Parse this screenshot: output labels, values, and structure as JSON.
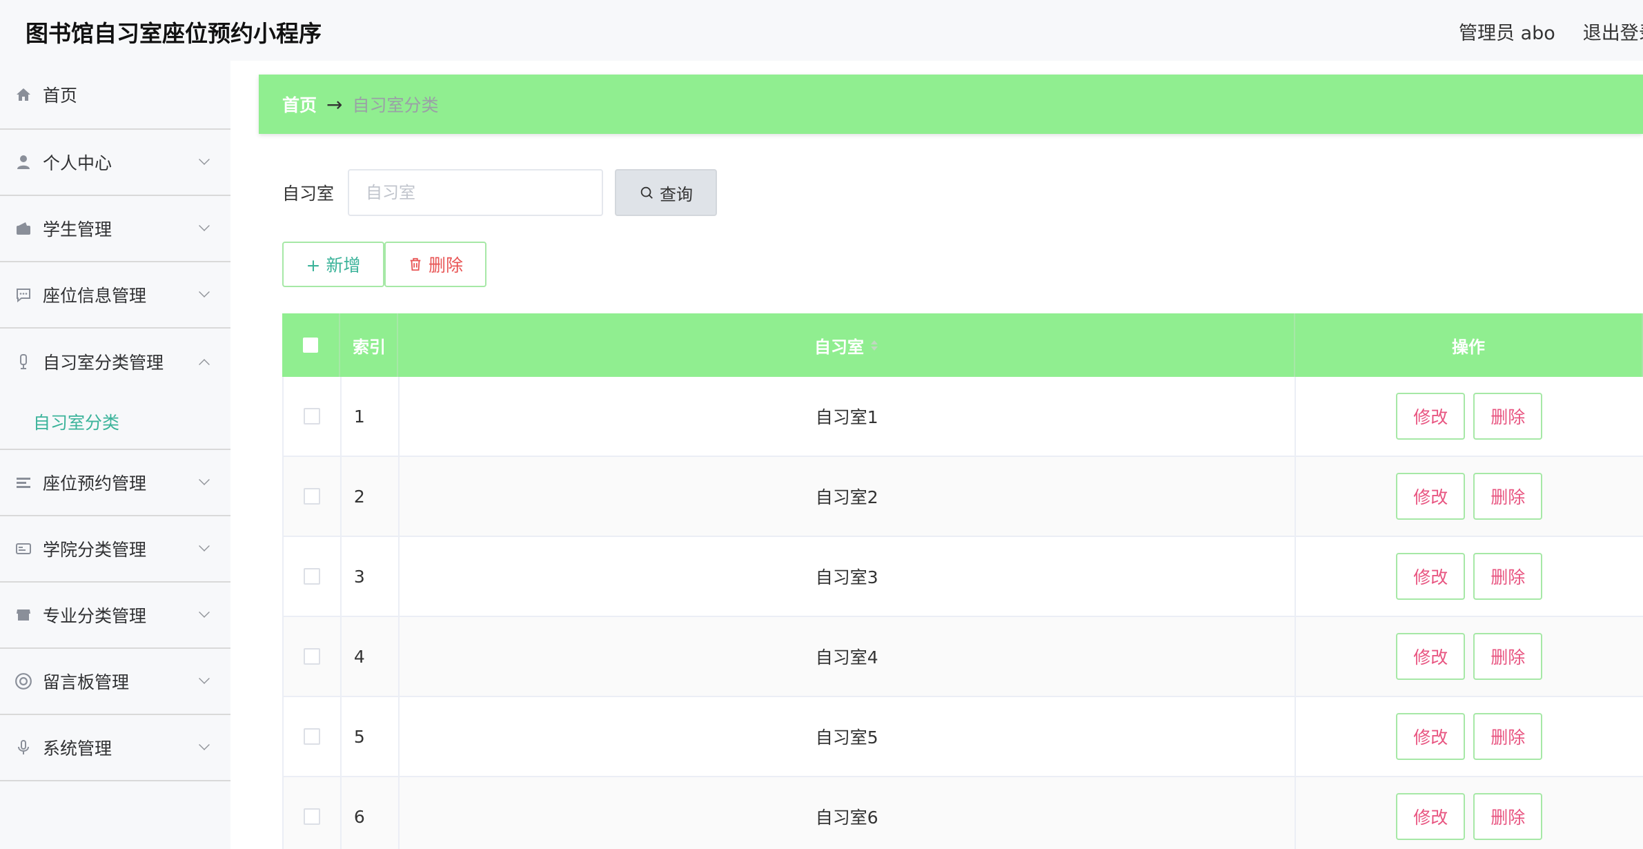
{
  "header": {
    "title": "图书馆自习室座位预约小程序",
    "admin": "管理员 abo",
    "logout": "退出登录"
  },
  "sidebar": {
    "items": [
      {
        "label": "首页",
        "icon": "home-icon"
      },
      {
        "label": "个人中心",
        "icon": "user-icon"
      },
      {
        "label": "学生管理",
        "icon": "wallet-icon"
      },
      {
        "label": "座位信息管理",
        "icon": "chat-icon"
      },
      {
        "label": "自习室分类管理",
        "icon": "microphone-icon",
        "sub": "自习室分类"
      },
      {
        "label": "座位预约管理",
        "icon": "list-icon"
      },
      {
        "label": "学院分类管理",
        "icon": "card-icon"
      },
      {
        "label": "专业分类管理",
        "icon": "shop-icon"
      },
      {
        "label": "留言板管理",
        "icon": "lifebuoy-icon"
      },
      {
        "label": "系统管理",
        "icon": "mic-icon"
      }
    ]
  },
  "breadcrumb": {
    "home": "首页",
    "arrow": "→",
    "current": "自习室分类"
  },
  "search": {
    "label": "自习室",
    "placeholder": "自习室",
    "button": "查询"
  },
  "actions": {
    "add": "+ 新增",
    "delete": "删除"
  },
  "table": {
    "headers": {
      "index": "索引",
      "room": "自习室",
      "ops": "操作"
    },
    "rows": [
      {
        "index": "1",
        "room": "自习室1"
      },
      {
        "index": "2",
        "room": "自习室2"
      },
      {
        "index": "3",
        "room": "自习室3"
      },
      {
        "index": "4",
        "room": "自习室4"
      },
      {
        "index": "5",
        "room": "自习室5"
      },
      {
        "index": "6",
        "room": "自习室6"
      }
    ],
    "edit_label": "修改",
    "delete_label": "删除"
  },
  "colors": {
    "accent_green": "#90ee90",
    "teal_text": "#3bb39a",
    "danger": "#e85454"
  }
}
